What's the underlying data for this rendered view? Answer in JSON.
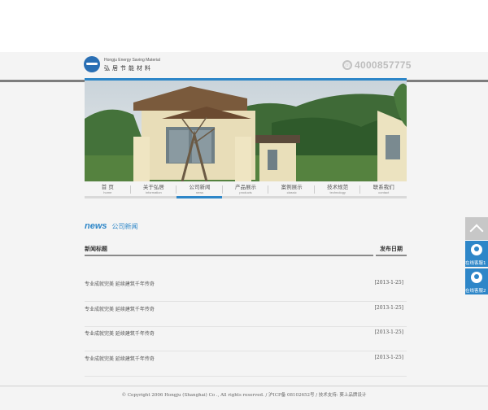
{
  "header": {
    "logo_en": "Hongju Energy Saving Material",
    "logo_cn": "弘居节能材料",
    "phone": "4000857775"
  },
  "nav": [
    {
      "cn": "首  页",
      "en": "home"
    },
    {
      "cn": "关于弘居",
      "en": "information"
    },
    {
      "cn": "公司新闻",
      "en": "news"
    },
    {
      "cn": "产品展示",
      "en": "products"
    },
    {
      "cn": "案例展示",
      "en": "classic"
    },
    {
      "cn": "技术规范",
      "en": "technology"
    },
    {
      "cn": "联系我们",
      "en": "contact"
    }
  ],
  "section": {
    "en": "news",
    "cn": "公司新闻"
  },
  "table": {
    "col_title": "新闻标题",
    "col_date": "发布日期",
    "rows": [
      {
        "title": "专业成就完美 延续建筑千年传奇",
        "date": "[2013-1-25]"
      },
      {
        "title": "专业成就完美 延续建筑千年传奇",
        "date": "[2013-1-25]"
      },
      {
        "title": "专业成就完美 延续建筑千年传奇",
        "date": "[2013-1-25]"
      },
      {
        "title": "专业成就完美 延续建筑千年传奇",
        "date": "[2013-1-25]"
      }
    ]
  },
  "footer": {
    "text": "© Copyright 2006 Hongju (Shanghai) Co ., All rights reserved. / 沪ICP备 08102652号 / 技术支持: 葵上品牌设计"
  },
  "sidebar": {
    "btn1": "在线客服1",
    "btn2": "在线客服2"
  },
  "icons": {
    "top": "chevron-up-icon",
    "service": "headset-icon",
    "phone": "phone-icon"
  },
  "colors": {
    "accent": "#2d86c8"
  }
}
